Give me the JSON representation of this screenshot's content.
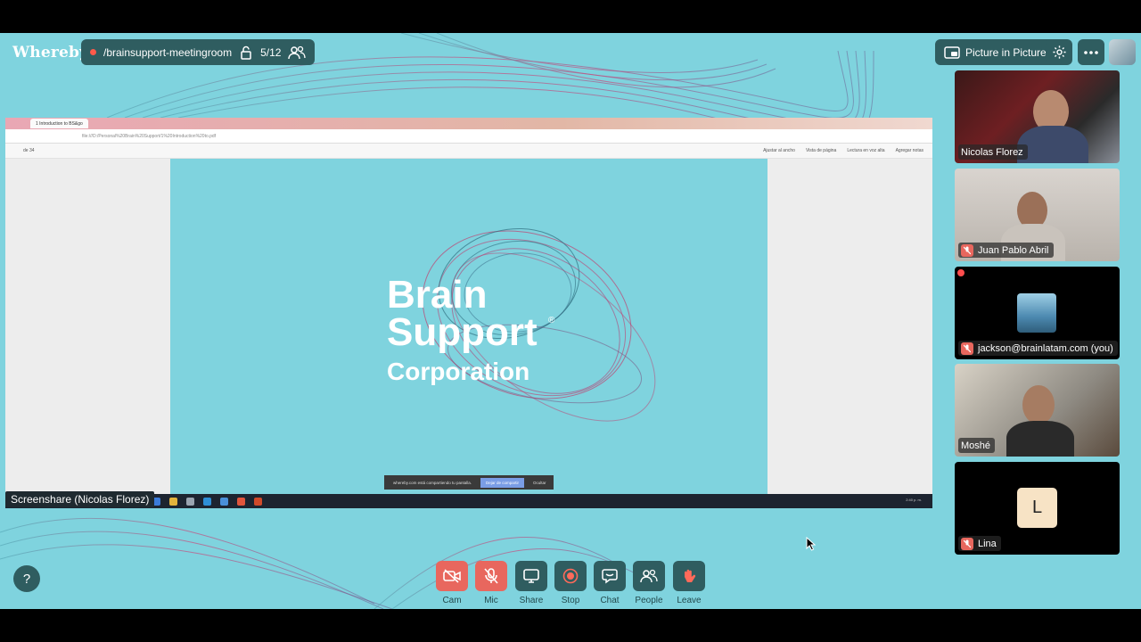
{
  "app": {
    "logo": "Whereby"
  },
  "room": {
    "name": "/brainsupport-meetingroom",
    "count": "5/12"
  },
  "top_actions": {
    "pip_label": "Picture in Picture"
  },
  "screenshare": {
    "label": "Screenshare (Nicolas Florez)",
    "tab_title": "1 Introduction to BS&go",
    "address": "file:///D:/Personal%20Brain%20Support/1%20Introduction%20to.pdf",
    "toolbar_items": [
      "Ajustar al ancho",
      "Vista de página",
      "Lectura en voz alta",
      "Agregar notas"
    ],
    "page_indicator": "de 34",
    "slide": {
      "line1": "Brain",
      "line2": "Support",
      "line3": "Corporation",
      "reg": "®"
    },
    "notice": {
      "text": "whereby.com está compartiendo tu pantalla.",
      "stop": "Dejar de compartir",
      "hide": "Ocultar"
    },
    "tray_time": "2:40 p. m."
  },
  "participants": [
    {
      "name": "Nicolas Florez",
      "muted": false
    },
    {
      "name": "Juan Pablo Abril",
      "muted": true
    },
    {
      "name": "jackson@brainlatam.com (you)",
      "muted": true
    },
    {
      "name": "Moshé",
      "muted": false
    },
    {
      "name": "Lina",
      "muted": true,
      "initial": "L"
    }
  ],
  "controls": {
    "cam": "Cam",
    "mic": "Mic",
    "share": "Share",
    "stop": "Stop",
    "chat": "Chat",
    "people": "People",
    "leave": "Leave",
    "help": "?"
  },
  "colors": {
    "accent_dark": "#2f5d60",
    "danger": "#e8675e",
    "background": "#7fd3de"
  }
}
